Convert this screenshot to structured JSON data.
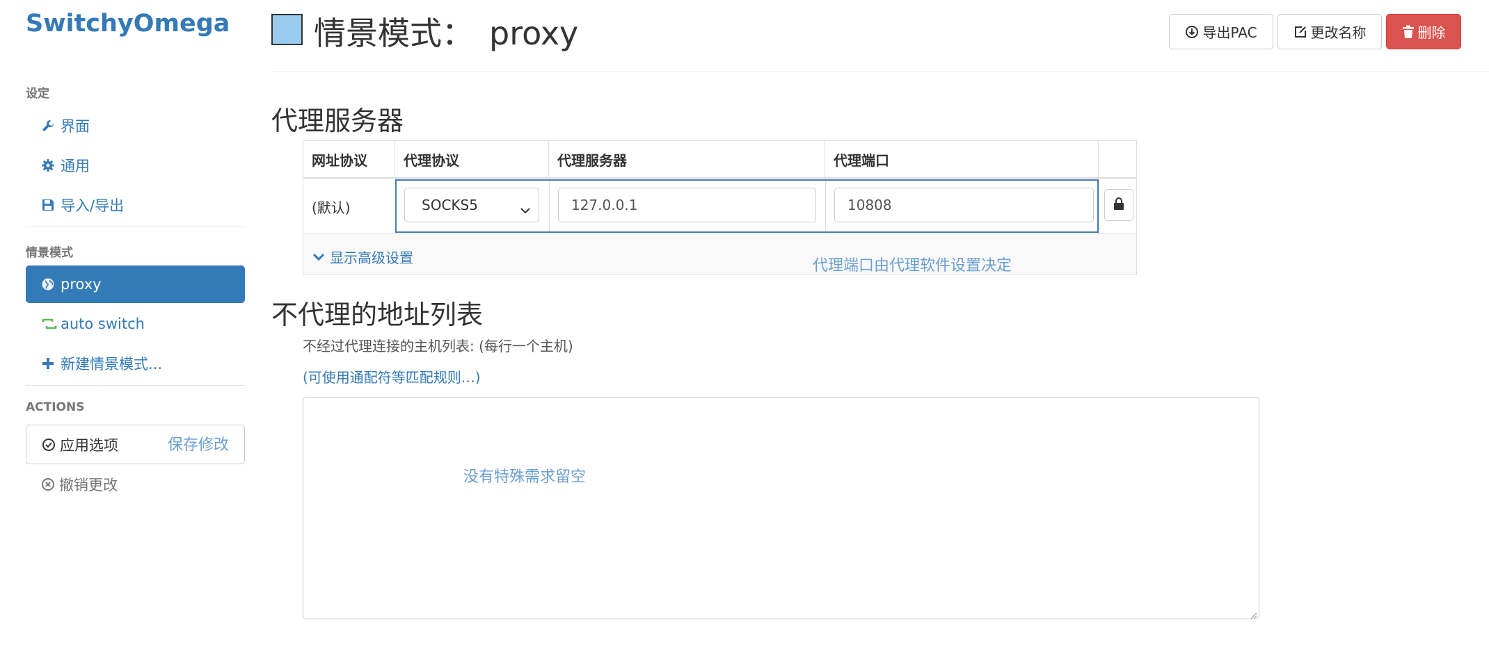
{
  "app": {
    "brand": "SwitchyOmega"
  },
  "sidebar": {
    "settings_header": "设定",
    "settings_items": [
      {
        "label": "界面",
        "icon": "wrench-icon"
      },
      {
        "label": "通用",
        "icon": "gear-icon"
      },
      {
        "label": "导入/导出",
        "icon": "floppy-disk-icon"
      }
    ],
    "profiles_header": "情景模式",
    "profiles": [
      {
        "label": "proxy",
        "icon": "globe-icon",
        "active": true
      },
      {
        "label": "auto switch",
        "icon": "retweet-icon",
        "active": false
      },
      {
        "label": "新建情景模式...",
        "icon": "plus-icon",
        "active": false
      }
    ],
    "actions_header": "ACTIONS",
    "apply_label": "应用选项",
    "save_note": "保存修改",
    "discard_label": "撤销更改"
  },
  "header": {
    "title_prefix": "情景模式：",
    "profile_name": "proxy",
    "profile_color": "#99ccee",
    "export_pac": "导出PAC",
    "rename": "更改名称",
    "delete": "删除"
  },
  "proxy_section": {
    "heading": "代理服务器",
    "columns": [
      "网址协议",
      "代理协议",
      "代理服务器",
      "代理端口"
    ],
    "row": {
      "scheme": "(默认)",
      "protocol": "SOCKS5",
      "server": "127.0.0.1",
      "port": "10808"
    },
    "advanced_link": "显示高级设置",
    "port_note": "代理端口由代理软件设置决定"
  },
  "bypass_section": {
    "heading": "不代理的地址列表",
    "help": "不经过代理连接的主机列表: (每行一个主机)",
    "wildcard_link": "(可使用通配符等匹配规则…)",
    "value": "",
    "empty_note": "没有特殊需求留空"
  },
  "colors": {
    "accent": "#337ab7",
    "danger": "#d9534f",
    "note": "#6a9fd0"
  }
}
